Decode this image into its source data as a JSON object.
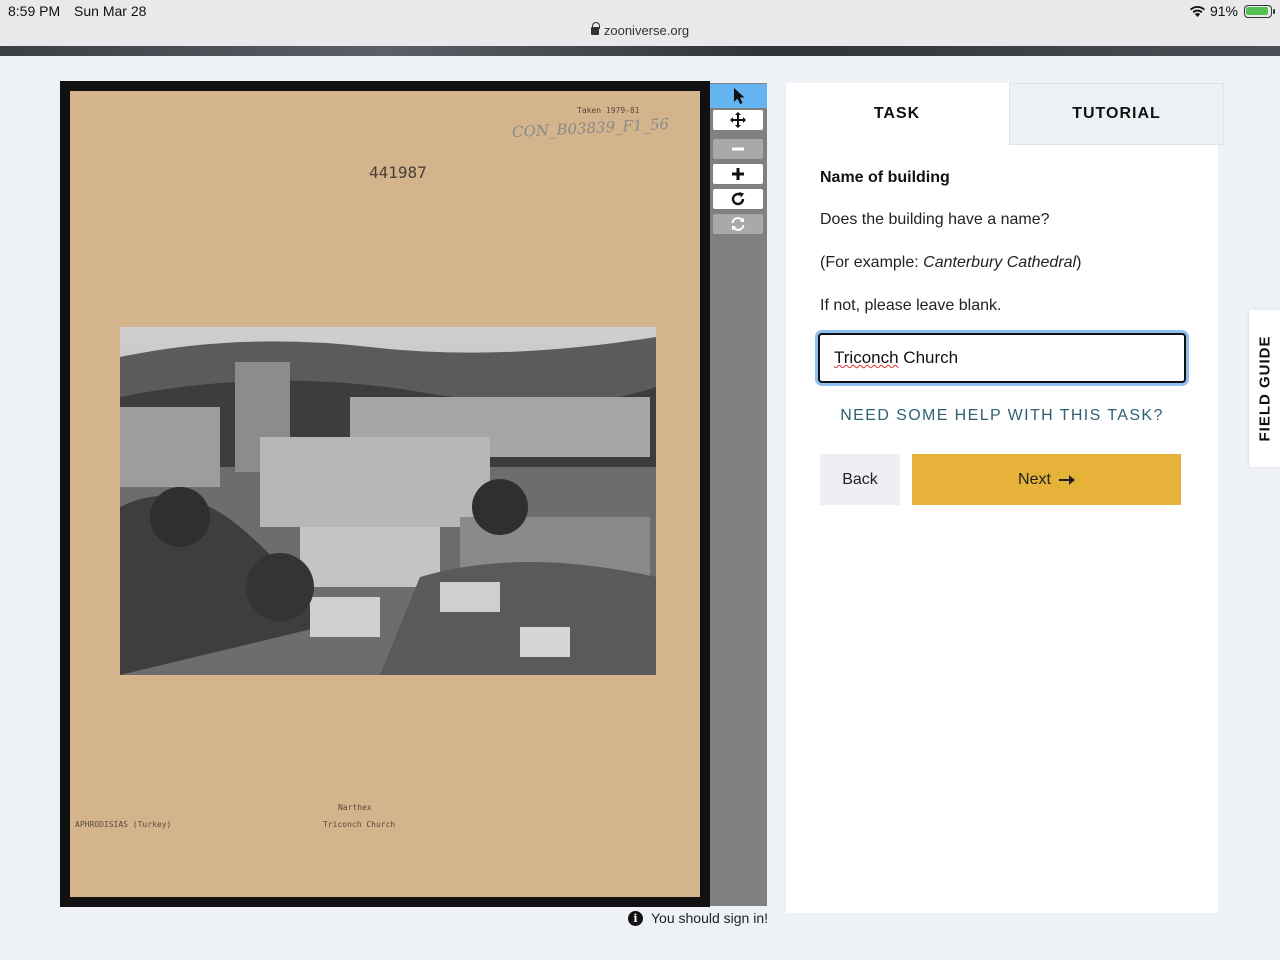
{
  "status": {
    "time": "8:59 PM",
    "date": "Sun Mar 28",
    "battery": "91%"
  },
  "browser": {
    "url": "zooniverse.org"
  },
  "subject": {
    "taken": "Taken 1979-81",
    "handwritten": "CON_B03839_F1_56",
    "number": "441987",
    "caption_line1": "Narthex",
    "caption_line2": "Triconch Church",
    "location": "APHRODISIAS (Turkey)"
  },
  "toolbar": {
    "tools": [
      "cursor-icon",
      "move-icon",
      "zoom-out-icon",
      "zoom-in-icon",
      "rotate-icon",
      "reset-icon"
    ]
  },
  "signin": {
    "text": "You should sign in!"
  },
  "tabs": {
    "task": "TASK",
    "tutorial": "TUTORIAL"
  },
  "task": {
    "title": "Name of building",
    "question": "Does the building have a name?",
    "example_prefix": "(For example: ",
    "example_italic": "Canterbury Cathedral",
    "example_suffix": ")",
    "instruction": "If not, please leave blank.",
    "answer_word1": "Triconch",
    "answer_word2": " Church",
    "help": "NEED SOME HELP WITH THIS TASK?",
    "back": "Back",
    "next": "Next"
  },
  "field_guide": {
    "label": "FIELD GUIDE"
  },
  "colors": {
    "next_button": "#e6b23a",
    "active_tool": "#63b4f0",
    "help_link": "#2f6172"
  }
}
